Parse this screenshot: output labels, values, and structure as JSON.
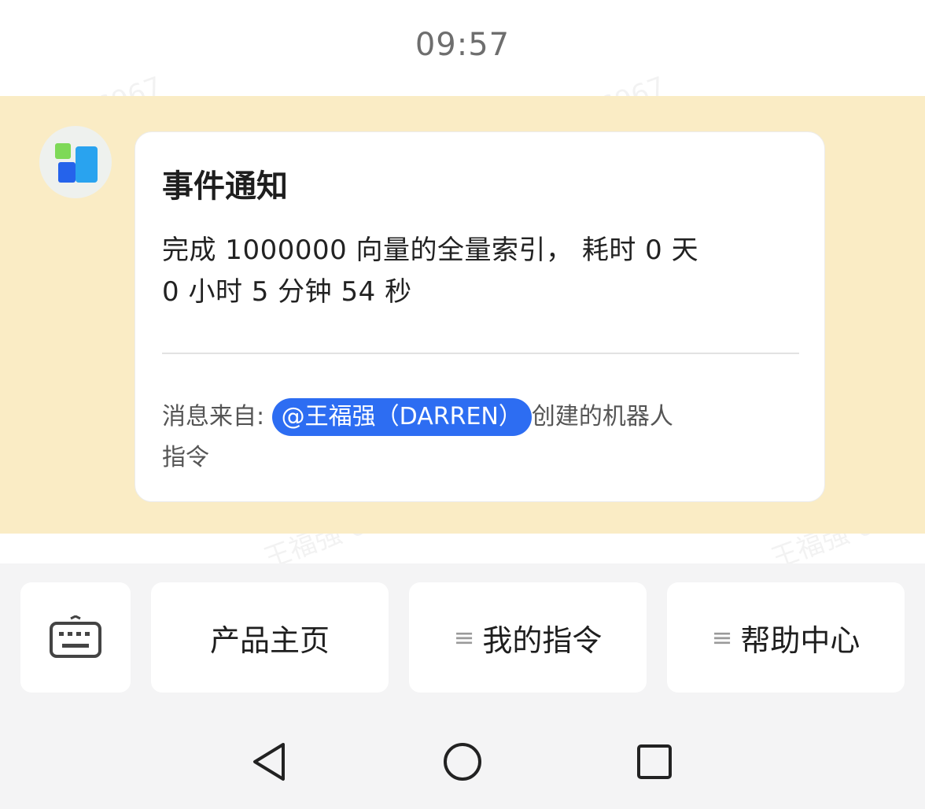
{
  "status_bar": {
    "time": "09:57"
  },
  "message": {
    "title": "事件通知",
    "body_line1": "完成 1000000 向量的全量索引， 耗时 0 天",
    "body_line2": "0 小时 5 分钟 54 秒",
    "source_prefix": "消息来自: ",
    "mention": "@王福强（DARREN）",
    "source_suffix": "创建的机器人",
    "source_line2": "指令"
  },
  "menu": {
    "keyboard_icon": "keyboard-icon",
    "items": [
      {
        "label": "产品主页",
        "has_list_icon": false
      },
      {
        "label": "我的指令",
        "has_list_icon": true
      },
      {
        "label": "帮助中心",
        "has_list_icon": true
      }
    ],
    "list_glyph": "≡"
  },
  "watermark": {
    "text": "王福强 6967"
  },
  "colors": {
    "message_band": "#faecc5",
    "mention_bg": "#2d6df2",
    "bottom_bg": "#f4f4f5"
  }
}
